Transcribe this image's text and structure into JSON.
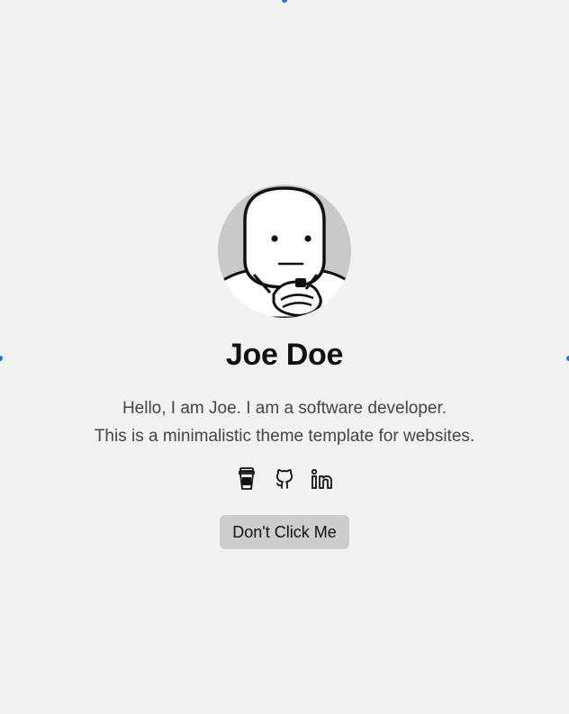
{
  "profile": {
    "name": "Joe Doe",
    "bio_line1": "Hello, I am Joe. I am a software developer.",
    "bio_line2": "This is a minimalistic theme template for websites."
  },
  "socials": [
    {
      "icon": "coffee-cup-icon"
    },
    {
      "icon": "github-icon"
    },
    {
      "icon": "linkedin-icon"
    }
  ],
  "button": {
    "label": "Don't Click Me"
  },
  "colors": {
    "background": "#f2f2f2",
    "button_bg": "#cdcdcd",
    "avatar_bg": "#c9c9c9",
    "edge_marker": "#1a73e8"
  }
}
